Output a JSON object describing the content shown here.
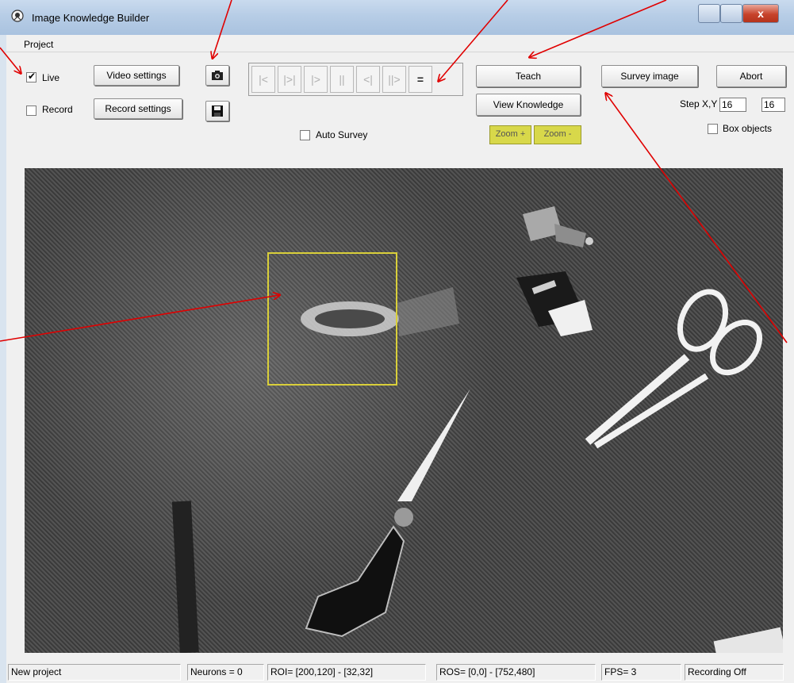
{
  "window": {
    "title": "Image Knowledge Builder",
    "close_glyph": "x"
  },
  "menu": {
    "project": "Project"
  },
  "controls": {
    "live_label": "Live",
    "live_checked": true,
    "record_label": "Record",
    "record_checked": false,
    "video_settings": "Video settings",
    "record_settings": "Record settings",
    "snapshot_icon": "camera-icon",
    "save_icon": "floppy-disk-icon",
    "auto_survey_label": "Auto Survey",
    "teach": "Teach",
    "view_knowledge": "View Knowledge",
    "zoom_in": "Zoom +",
    "zoom_out": "Zoom -",
    "survey_image": "Survey image",
    "abort": "Abort",
    "step_label": "Step X,Y",
    "step_x": "16",
    "step_y": "16",
    "box_objects_label": "Box objects",
    "accent_yellow": "#d8d84a"
  },
  "transport": {
    "buttons": [
      "|<",
      "|>|",
      "|>",
      "||",
      "<|",
      "||>",
      "="
    ]
  },
  "status": {
    "project": "New project",
    "neurons": "Neurons = 0",
    "roi": "ROI= [200,120] - [32,32]",
    "ros": "ROS= [0,0] - [752,480]",
    "fps": "FPS= 3",
    "recording": "Recording Off"
  },
  "annotation_color": "#e00000"
}
